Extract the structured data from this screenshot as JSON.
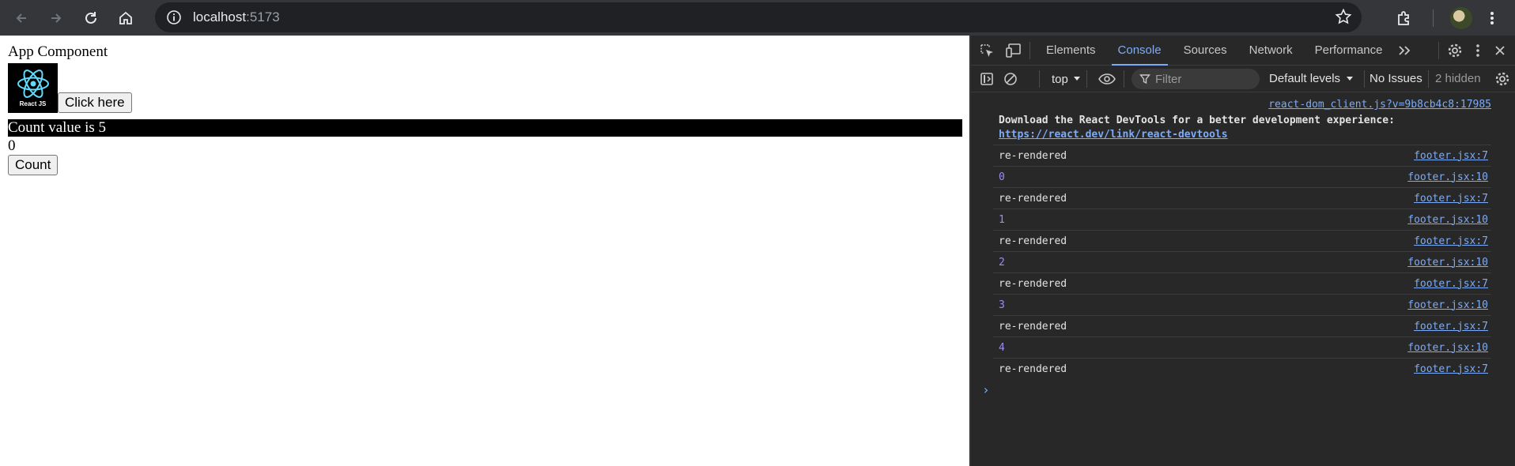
{
  "browser": {
    "url_host": "localhost",
    "url_port": ":5173"
  },
  "app": {
    "title": "App Component",
    "logo_text": "React JS",
    "click_button": "Click here",
    "count_bar": "Count value is 5",
    "count_value": "0",
    "count_button": "Count"
  },
  "devtools": {
    "tabs": [
      "Elements",
      "Console",
      "Sources",
      "Network",
      "Performance"
    ],
    "active_tab": "Console",
    "context": "top",
    "filter_placeholder": "Filter",
    "levels": "Default levels",
    "issues": "No Issues",
    "hidden": "2 hidden",
    "top_link": "react-dom_client.js?v=9b8cb4c8:17985",
    "devtools_msg": "Download the React DevTools for a better development experience:",
    "devtools_link": "https://react.dev/link/react-devtools",
    "logs": [
      {
        "text": "re-rendered",
        "src": "footer.jsx:7",
        "kind": "txt"
      },
      {
        "text": "0",
        "src": "footer.jsx:10",
        "kind": "num"
      },
      {
        "text": "re-rendered",
        "src": "footer.jsx:7",
        "kind": "txt"
      },
      {
        "text": "1",
        "src": "footer.jsx:10",
        "kind": "num"
      },
      {
        "text": "re-rendered",
        "src": "footer.jsx:7",
        "kind": "txt"
      },
      {
        "text": "2",
        "src": "footer.jsx:10",
        "kind": "num"
      },
      {
        "text": "re-rendered",
        "src": "footer.jsx:7",
        "kind": "txt"
      },
      {
        "text": "3",
        "src": "footer.jsx:10",
        "kind": "num"
      },
      {
        "text": "re-rendered",
        "src": "footer.jsx:7",
        "kind": "txt"
      },
      {
        "text": "4",
        "src": "footer.jsx:10",
        "kind": "num"
      },
      {
        "text": "re-rendered",
        "src": "footer.jsx:7",
        "kind": "txt"
      }
    ],
    "prompt": "›"
  },
  "colors": {
    "accent": "#7cacf8",
    "number": "#9e8cf4",
    "devtools_bg": "#282828"
  }
}
